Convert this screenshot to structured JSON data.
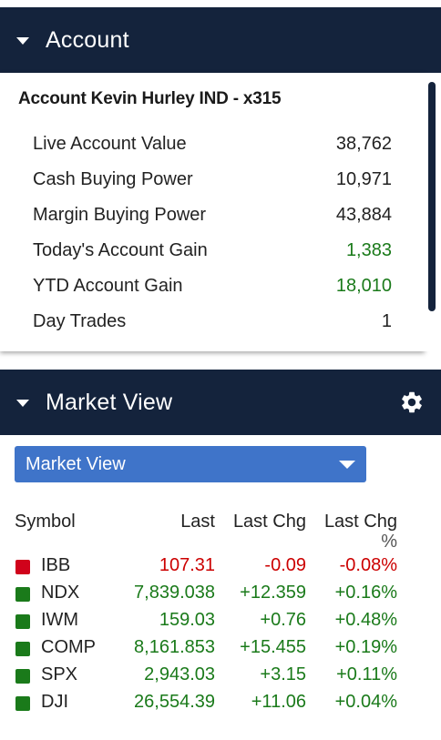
{
  "account_panel": {
    "title": "Account",
    "account_name": "Account Kevin Hurley IND - x315",
    "rows": [
      {
        "label": "Live Account Value",
        "value": "38,762",
        "status": "neutral"
      },
      {
        "label": "Cash Buying Power",
        "value": "10,971",
        "status": "neutral"
      },
      {
        "label": "Margin Buying Power",
        "value": "43,884",
        "status": "neutral"
      },
      {
        "label": "Today's Account Gain",
        "value": "1,383",
        "status": "gain"
      },
      {
        "label": "YTD Account Gain",
        "value": "18,010",
        "status": "gain"
      },
      {
        "label": "Day Trades",
        "value": "1",
        "status": "neutral"
      }
    ]
  },
  "market_panel": {
    "title": "Market View",
    "settings_icon": "gear-icon",
    "dropdown_value": "Market View",
    "columns": {
      "symbol": "Symbol",
      "last": "Last",
      "last_chg": "Last Chg",
      "last_chg_pct_line1": "Last Chg",
      "last_chg_pct_line2": "%"
    },
    "rows": [
      {
        "symbol": "IBB",
        "last": "107.31",
        "chg": "-0.09",
        "pct": "-0.08%",
        "direction": "down"
      },
      {
        "symbol": "NDX",
        "last": "7,839.038",
        "chg": "+12.359",
        "pct": "+0.16%",
        "direction": "up"
      },
      {
        "symbol": "IWM",
        "last": "159.03",
        "chg": "+0.76",
        "pct": "+0.48%",
        "direction": "up"
      },
      {
        "symbol": "COMP",
        "last": "8,161.853",
        "chg": "+15.455",
        "pct": "+0.19%",
        "direction": "up"
      },
      {
        "symbol": "SPX",
        "last": "2,943.03",
        "chg": "+3.15",
        "pct": "+0.11%",
        "direction": "up"
      },
      {
        "symbol": "DJI",
        "last": "26,554.39",
        "chg": "+11.06",
        "pct": "+0.04%",
        "direction": "up"
      }
    ]
  },
  "colors": {
    "header_bg": "#14233c",
    "dropdown_bg": "#3f74c9",
    "up": "#1a7a1a",
    "down": "#cc0000",
    "up_square": "#1a7a1a",
    "down_square": "#d0021b"
  }
}
